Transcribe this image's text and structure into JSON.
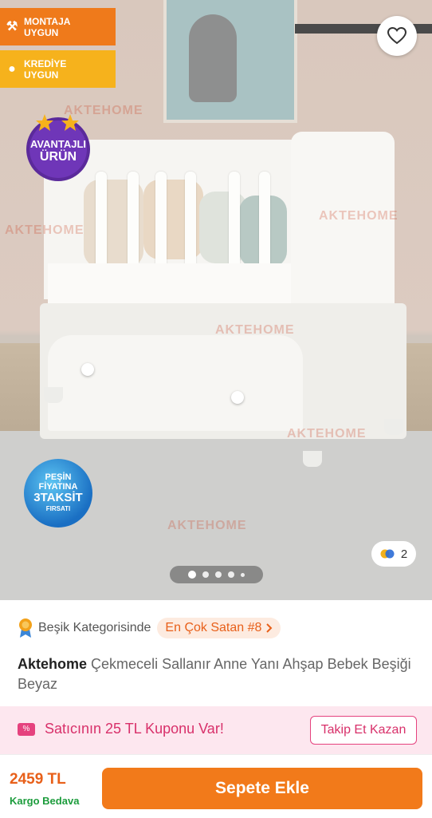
{
  "badges": {
    "montaja": {
      "line1": "MONTAJA",
      "line2": "UYGUN"
    },
    "kredi": {
      "line1": "KREDİYE",
      "line2": "UYGUN"
    }
  },
  "avantaj": {
    "line1": "AVANTAJLI",
    "line2": "ÜRÜN"
  },
  "pesin": {
    "line1": "PEŞİN",
    "line2": "FİYATINA",
    "line3": "3TAKSİT",
    "line4": "FIRSATI"
  },
  "watermark": "AKTEHOME",
  "gallery": {
    "image_count": "2"
  },
  "category": {
    "label": "Beşik Kategorisinde",
    "bestseller": "En Çok Satan #8"
  },
  "product": {
    "brand": "Aktehome",
    "name": "Çekmeceli Sallanır Anne Yanı Ahşap Bebek Beşiği Beyaz"
  },
  "coupon": {
    "text": "Satıcının 25 TL Kuponu Var!",
    "button": "Takip Et Kazan"
  },
  "purchase": {
    "price": "2459 TL",
    "shipping": "Kargo Bedava",
    "button": "Sepete Ekle"
  },
  "colors": {
    "accent": "#f27a1a",
    "coupon": "#d8306a",
    "shipping": "#1c9c3c"
  }
}
